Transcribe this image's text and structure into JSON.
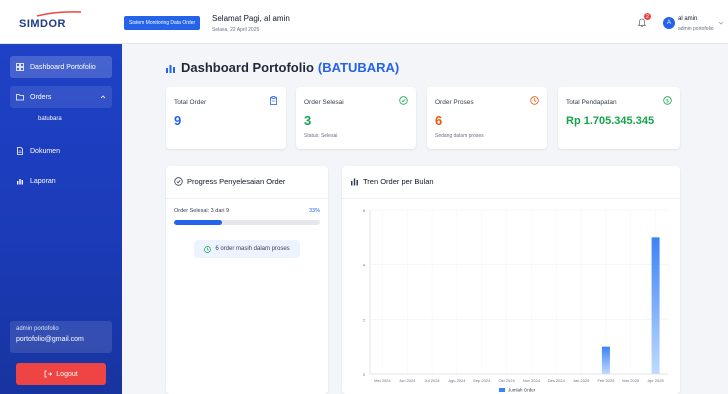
{
  "brand": {
    "name": "SIMDOR"
  },
  "sidebar": {
    "items": [
      {
        "label": "Dashboard Portofolio"
      },
      {
        "label": "Orders"
      },
      {
        "label": "batubara"
      },
      {
        "label": "Dokumen"
      },
      {
        "label": "Laporan"
      }
    ],
    "user_role": "admin portofolio",
    "user_email": "portofolio@gmail.com",
    "logout_label": "Logout"
  },
  "topbar": {
    "system_badge": "Sistem Monitoring Data Order",
    "greeting": "Selamat Pagi, al amin",
    "date": "Selasa, 22 April 2025",
    "notif_count": "2",
    "avatar_initial": "A",
    "user_name": "al amin",
    "user_role": "admin portofolio"
  },
  "page": {
    "title": "Dashboard Portofolio",
    "title_accent": "(BATUBARA)"
  },
  "stats": [
    {
      "label": "Total Order",
      "value": "9",
      "sub": ""
    },
    {
      "label": "Order Selesai",
      "value": "3",
      "sub": "Status: Selesai"
    },
    {
      "label": "Order Proses",
      "value": "6",
      "sub": "Sedang dalam proses"
    },
    {
      "label": "Total Pendapatan",
      "value": "Rp 1.705.345.345",
      "sub": ""
    }
  ],
  "colors": {
    "blue": "#2563eb",
    "green": "#16a34a",
    "orange": "#ea580c",
    "red": "#ef4444"
  },
  "progress": {
    "title": "Progress Penyelesaian Order",
    "label": "Order Selesai: 3 dari 9",
    "percent_label": "33%",
    "fraction": 0.33,
    "info": "6 order masih dalam proses"
  },
  "chart_data": {
    "type": "bar",
    "title": "Tren Order per Bulan",
    "categories": [
      "Mei 2024",
      "Jun 2024",
      "Jul 2024",
      "Agu 2024",
      "Sep 2024",
      "Okt 2024",
      "Nov 2024",
      "Des 2024",
      "Jan 2025",
      "Feb 2025",
      "Mar 2025",
      "Apr 2025"
    ],
    "series": [
      {
        "name": "Jumlah Order",
        "values": [
          0,
          0,
          0,
          0,
          0,
          0,
          0,
          0,
          0,
          1,
          0,
          5
        ]
      }
    ],
    "ylim": [
      0,
      6
    ],
    "yticks": [
      "0",
      "2",
      "4",
      "6"
    ],
    "grid": true,
    "legend": "bottom"
  }
}
